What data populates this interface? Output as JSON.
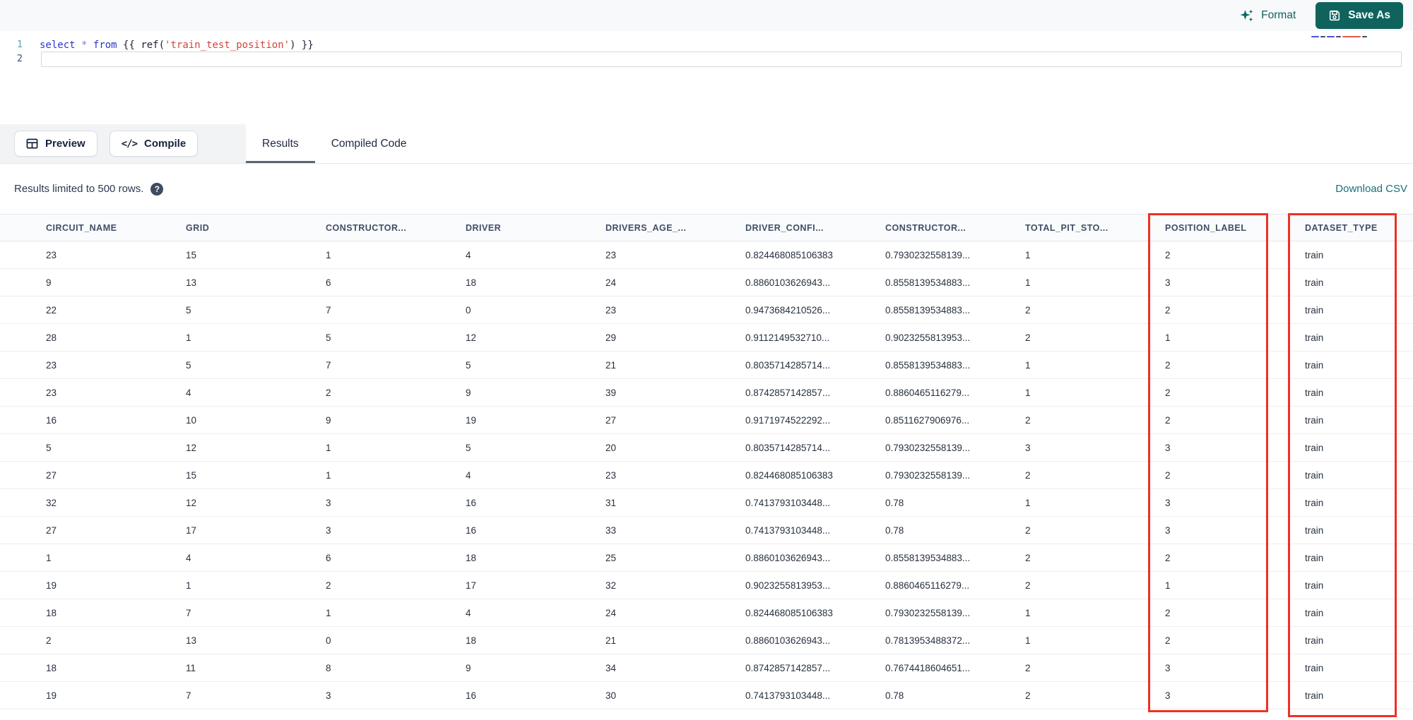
{
  "topbar": {
    "format_label": "Format",
    "save_as_label": "Save As"
  },
  "editor": {
    "line_numbers": [
      "1",
      "2"
    ],
    "code_text": "select * from {{ ref('train_test_position') }}",
    "code_tokens": [
      {
        "text": "select",
        "type": "keyword"
      },
      {
        "text": " ",
        "type": "plain"
      },
      {
        "text": "*",
        "type": "operator"
      },
      {
        "text": " ",
        "type": "plain"
      },
      {
        "text": "from",
        "type": "keyword"
      },
      {
        "text": " {{ ref(",
        "type": "plain"
      },
      {
        "text": "'train_test_position'",
        "type": "string"
      },
      {
        "text": ") }}",
        "type": "plain"
      }
    ]
  },
  "actions": {
    "preview_label": "Preview",
    "compile_label": "Compile",
    "compile_glyph": "</>"
  },
  "tabs": [
    {
      "label": "Results",
      "active": true
    },
    {
      "label": "Compiled Code",
      "active": false
    }
  ],
  "results_bar": {
    "limit_note": "Results limited to 500 rows.",
    "help_icon_glyph": "?",
    "download_label": "Download CSV"
  },
  "table": {
    "columns": [
      "CIRCUIT_NAME",
      "GRID",
      "CONSTRUCTOR...",
      "DRIVER",
      "DRIVERS_AGE_...",
      "DRIVER_CONFI...",
      "CONSTRUCTOR...",
      "TOTAL_PIT_STO...",
      "POSITION_LABEL",
      "DATASET_TYPE"
    ],
    "rows": [
      [
        "23",
        "15",
        "1",
        "4",
        "23",
        "0.824468085106383",
        "0.7930232558139...",
        "1",
        "2",
        "train"
      ],
      [
        "9",
        "13",
        "6",
        "18",
        "24",
        "0.8860103626943...",
        "0.8558139534883...",
        "1",
        "3",
        "train"
      ],
      [
        "22",
        "5",
        "7",
        "0",
        "23",
        "0.9473684210526...",
        "0.8558139534883...",
        "2",
        "2",
        "train"
      ],
      [
        "28",
        "1",
        "5",
        "12",
        "29",
        "0.9112149532710...",
        "0.9023255813953...",
        "2",
        "1",
        "train"
      ],
      [
        "23",
        "5",
        "7",
        "5",
        "21",
        "0.8035714285714...",
        "0.8558139534883...",
        "1",
        "2",
        "train"
      ],
      [
        "23",
        "4",
        "2",
        "9",
        "39",
        "0.8742857142857...",
        "0.8860465116279...",
        "1",
        "2",
        "train"
      ],
      [
        "16",
        "10",
        "9",
        "19",
        "27",
        "0.9171974522292...",
        "0.8511627906976...",
        "2",
        "2",
        "train"
      ],
      [
        "5",
        "12",
        "1",
        "5",
        "20",
        "0.8035714285714...",
        "0.7930232558139...",
        "3",
        "3",
        "train"
      ],
      [
        "27",
        "15",
        "1",
        "4",
        "23",
        "0.824468085106383",
        "0.7930232558139...",
        "2",
        "2",
        "train"
      ],
      [
        "32",
        "12",
        "3",
        "16",
        "31",
        "0.7413793103448...",
        "0.78",
        "1",
        "3",
        "train"
      ],
      [
        "27",
        "17",
        "3",
        "16",
        "33",
        "0.7413793103448...",
        "0.78",
        "2",
        "3",
        "train"
      ],
      [
        "1",
        "4",
        "6",
        "18",
        "25",
        "0.8860103626943...",
        "0.8558139534883...",
        "2",
        "2",
        "train"
      ],
      [
        "19",
        "1",
        "2",
        "17",
        "32",
        "0.9023255813953...",
        "0.8860465116279...",
        "2",
        "1",
        "train"
      ],
      [
        "18",
        "7",
        "1",
        "4",
        "24",
        "0.824468085106383",
        "0.7930232558139...",
        "1",
        "2",
        "train"
      ],
      [
        "2",
        "13",
        "0",
        "18",
        "21",
        "0.8860103626943...",
        "0.7813953488372...",
        "1",
        "2",
        "train"
      ],
      [
        "18",
        "11",
        "8",
        "9",
        "34",
        "0.8742857142857...",
        "0.7674418604651...",
        "2",
        "3",
        "train"
      ],
      [
        "19",
        "7",
        "3",
        "16",
        "30",
        "0.7413793103448...",
        "0.78",
        "2",
        "3",
        "train"
      ]
    ],
    "highlighted_columns": [
      "POSITION_LABEL",
      "DATASET_TYPE"
    ]
  },
  "colors": {
    "accent_teal": "#10635d",
    "download_teal": "#17717b",
    "highlight_red": "#f03022",
    "keyword_blue": "#2d35c8",
    "string_red": "#d4453c"
  }
}
